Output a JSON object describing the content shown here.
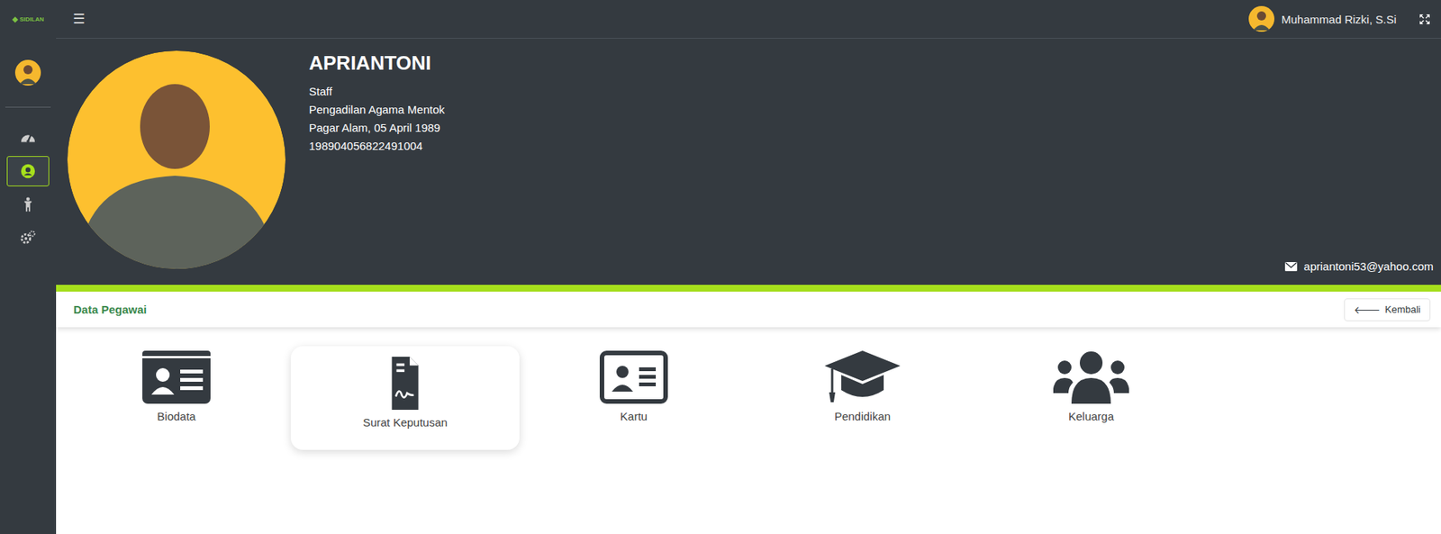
{
  "app": {
    "logo": "SIDILAN"
  },
  "sidebar": {
    "items": [
      {
        "name": "dashboard",
        "selected": false
      },
      {
        "name": "pegawai",
        "selected": true
      },
      {
        "name": "pensiun",
        "selected": false
      },
      {
        "name": "pengaturan",
        "selected": false
      }
    ]
  },
  "topbar": {
    "menu_icon": "☰",
    "user_name": "Muhammad Rizki, S.Si"
  },
  "profile": {
    "name": "APRIANTONI",
    "position": "Staff",
    "office": "Pengadilan Agama Mentok",
    "birth": "Pagar Alam, 05 April 1989",
    "nip": "198904056822491004",
    "email": "apriantoni53@yahoo.com"
  },
  "section": {
    "title": "Data Pegawai",
    "back_button": "Kembali",
    "back_icon": "🡐"
  },
  "menu": [
    {
      "label": "Biodata",
      "icon": "biodata",
      "selected": false
    },
    {
      "label": "Surat Keputusan",
      "icon": "sk",
      "selected": true
    },
    {
      "label": "Kartu",
      "icon": "kartu",
      "selected": false
    },
    {
      "label": "Pendidikan",
      "icon": "pendidikan",
      "selected": false
    },
    {
      "label": "Keluarga",
      "icon": "keluarga",
      "selected": false
    }
  ]
}
